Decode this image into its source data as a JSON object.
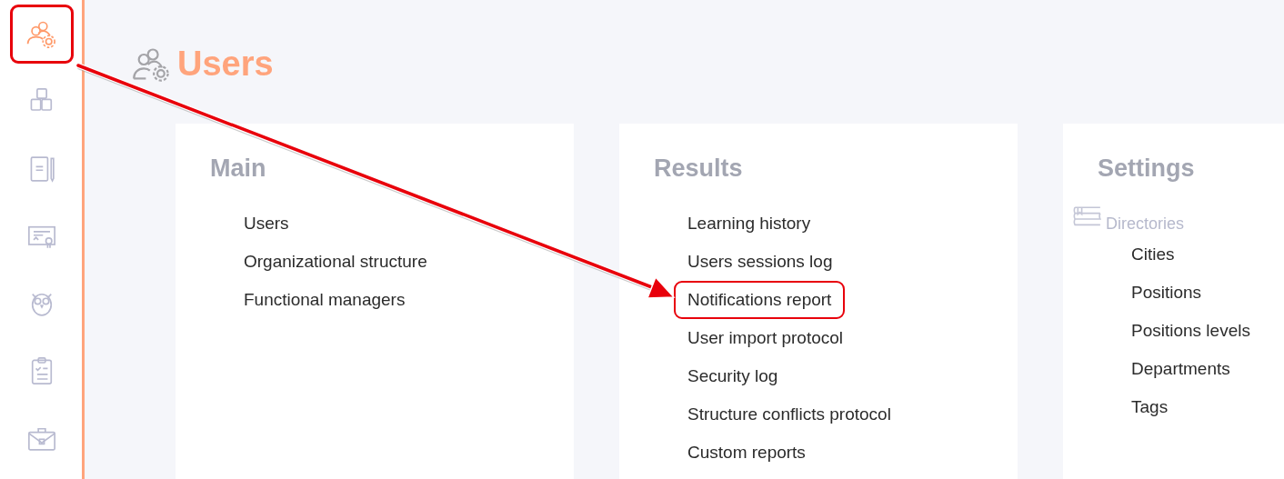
{
  "sidebar": {
    "items": [
      {
        "selected": true,
        "highlighted": true
      },
      {
        "selected": false,
        "highlighted": false
      },
      {
        "selected": false,
        "highlighted": false
      },
      {
        "selected": false,
        "highlighted": false
      },
      {
        "selected": false,
        "highlighted": false
      },
      {
        "selected": false,
        "highlighted": false
      },
      {
        "selected": false,
        "highlighted": false
      }
    ]
  },
  "page": {
    "title": "Users"
  },
  "sections": [
    {
      "heading": "Main",
      "items": [
        {
          "label": "Users",
          "highlighted": false
        },
        {
          "label": "Organizational structure",
          "highlighted": false
        },
        {
          "label": "Functional managers",
          "highlighted": false
        }
      ]
    },
    {
      "heading": "Results",
      "items": [
        {
          "label": "Learning history",
          "highlighted": false
        },
        {
          "label": "Users sessions log",
          "highlighted": false
        },
        {
          "label": "Notifications report",
          "highlighted": true
        },
        {
          "label": "User import protocol",
          "highlighted": false
        },
        {
          "label": "Security log",
          "highlighted": false
        },
        {
          "label": "Structure conflicts protocol",
          "highlighted": false
        },
        {
          "label": "Custom reports",
          "highlighted": false
        }
      ]
    },
    {
      "heading": "Settings",
      "group": {
        "label": "Directories",
        "items": [
          {
            "label": "Cities",
            "highlighted": false
          },
          {
            "label": "Positions",
            "highlighted": false
          },
          {
            "label": "Positions levels",
            "highlighted": false
          },
          {
            "label": "Departments",
            "highlighted": false
          },
          {
            "label": "Tags",
            "highlighted": false
          }
        ]
      }
    }
  ],
  "annotation": {
    "arrow": true
  }
}
